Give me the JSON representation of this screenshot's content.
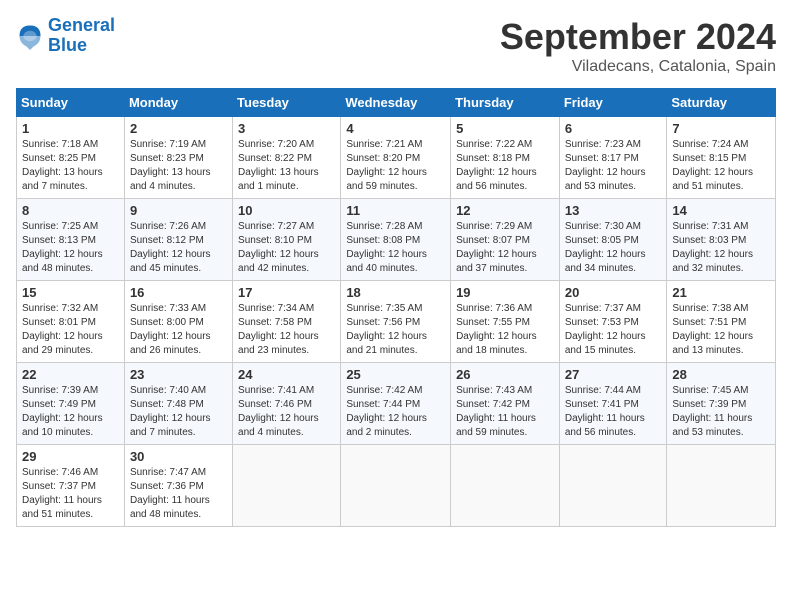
{
  "header": {
    "logo_general": "General",
    "logo_blue": "Blue",
    "month_title": "September 2024",
    "subtitle": "Viladecans, Catalonia, Spain"
  },
  "calendar": {
    "days_of_week": [
      "Sunday",
      "Monday",
      "Tuesday",
      "Wednesday",
      "Thursday",
      "Friday",
      "Saturday"
    ],
    "weeks": [
      [
        {
          "day": "",
          "info": ""
        },
        {
          "day": "2",
          "info": "Sunrise: 7:19 AM\nSunset: 8:23 PM\nDaylight: 13 hours and 4 minutes."
        },
        {
          "day": "3",
          "info": "Sunrise: 7:20 AM\nSunset: 8:22 PM\nDaylight: 13 hours and 1 minute."
        },
        {
          "day": "4",
          "info": "Sunrise: 7:21 AM\nSunset: 8:20 PM\nDaylight: 12 hours and 59 minutes."
        },
        {
          "day": "5",
          "info": "Sunrise: 7:22 AM\nSunset: 8:18 PM\nDaylight: 12 hours and 56 minutes."
        },
        {
          "day": "6",
          "info": "Sunrise: 7:23 AM\nSunset: 8:17 PM\nDaylight: 12 hours and 53 minutes."
        },
        {
          "day": "7",
          "info": "Sunrise: 7:24 AM\nSunset: 8:15 PM\nDaylight: 12 hours and 51 minutes."
        }
      ],
      [
        {
          "day": "8",
          "info": "Sunrise: 7:25 AM\nSunset: 8:13 PM\nDaylight: 12 hours and 48 minutes."
        },
        {
          "day": "9",
          "info": "Sunrise: 7:26 AM\nSunset: 8:12 PM\nDaylight: 12 hours and 45 minutes."
        },
        {
          "day": "10",
          "info": "Sunrise: 7:27 AM\nSunset: 8:10 PM\nDaylight: 12 hours and 42 minutes."
        },
        {
          "day": "11",
          "info": "Sunrise: 7:28 AM\nSunset: 8:08 PM\nDaylight: 12 hours and 40 minutes."
        },
        {
          "day": "12",
          "info": "Sunrise: 7:29 AM\nSunset: 8:07 PM\nDaylight: 12 hours and 37 minutes."
        },
        {
          "day": "13",
          "info": "Sunrise: 7:30 AM\nSunset: 8:05 PM\nDaylight: 12 hours and 34 minutes."
        },
        {
          "day": "14",
          "info": "Sunrise: 7:31 AM\nSunset: 8:03 PM\nDaylight: 12 hours and 32 minutes."
        }
      ],
      [
        {
          "day": "15",
          "info": "Sunrise: 7:32 AM\nSunset: 8:01 PM\nDaylight: 12 hours and 29 minutes."
        },
        {
          "day": "16",
          "info": "Sunrise: 7:33 AM\nSunset: 8:00 PM\nDaylight: 12 hours and 26 minutes."
        },
        {
          "day": "17",
          "info": "Sunrise: 7:34 AM\nSunset: 7:58 PM\nDaylight: 12 hours and 23 minutes."
        },
        {
          "day": "18",
          "info": "Sunrise: 7:35 AM\nSunset: 7:56 PM\nDaylight: 12 hours and 21 minutes."
        },
        {
          "day": "19",
          "info": "Sunrise: 7:36 AM\nSunset: 7:55 PM\nDaylight: 12 hours and 18 minutes."
        },
        {
          "day": "20",
          "info": "Sunrise: 7:37 AM\nSunset: 7:53 PM\nDaylight: 12 hours and 15 minutes."
        },
        {
          "day": "21",
          "info": "Sunrise: 7:38 AM\nSunset: 7:51 PM\nDaylight: 12 hours and 13 minutes."
        }
      ],
      [
        {
          "day": "22",
          "info": "Sunrise: 7:39 AM\nSunset: 7:49 PM\nDaylight: 12 hours and 10 minutes."
        },
        {
          "day": "23",
          "info": "Sunrise: 7:40 AM\nSunset: 7:48 PM\nDaylight: 12 hours and 7 minutes."
        },
        {
          "day": "24",
          "info": "Sunrise: 7:41 AM\nSunset: 7:46 PM\nDaylight: 12 hours and 4 minutes."
        },
        {
          "day": "25",
          "info": "Sunrise: 7:42 AM\nSunset: 7:44 PM\nDaylight: 12 hours and 2 minutes."
        },
        {
          "day": "26",
          "info": "Sunrise: 7:43 AM\nSunset: 7:42 PM\nDaylight: 11 hours and 59 minutes."
        },
        {
          "day": "27",
          "info": "Sunrise: 7:44 AM\nSunset: 7:41 PM\nDaylight: 11 hours and 56 minutes."
        },
        {
          "day": "28",
          "info": "Sunrise: 7:45 AM\nSunset: 7:39 PM\nDaylight: 11 hours and 53 minutes."
        }
      ],
      [
        {
          "day": "29",
          "info": "Sunrise: 7:46 AM\nSunset: 7:37 PM\nDaylight: 11 hours and 51 minutes."
        },
        {
          "day": "30",
          "info": "Sunrise: 7:47 AM\nSunset: 7:36 PM\nDaylight: 11 hours and 48 minutes."
        },
        {
          "day": "",
          "info": ""
        },
        {
          "day": "",
          "info": ""
        },
        {
          "day": "",
          "info": ""
        },
        {
          "day": "",
          "info": ""
        },
        {
          "day": "",
          "info": ""
        }
      ]
    ],
    "week1_day1": {
      "day": "1",
      "info": "Sunrise: 7:18 AM\nSunset: 8:25 PM\nDaylight: 13 hours and 7 minutes."
    }
  }
}
